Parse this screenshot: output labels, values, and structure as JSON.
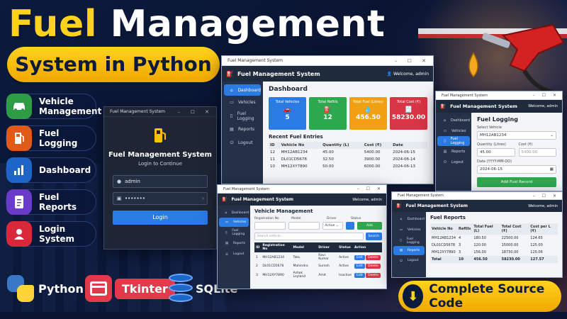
{
  "hero": {
    "title_line1_yellow": "Fuel",
    "title_line1_white": "Management",
    "title_line2": "System in Python"
  },
  "features": [
    {
      "label": "Vehicle Management",
      "icon": "car-icon",
      "color": "#2e9b45"
    },
    {
      "label": "Fuel Logging",
      "icon": "fuel-pump-icon",
      "color": "#e05a1a"
    },
    {
      "label": "Dashboard",
      "icon": "bar-chart-icon",
      "color": "#1f64c7"
    },
    {
      "label": "Fuel Reports",
      "icon": "document-icon",
      "color": "#6a3bc9"
    },
    {
      "label": "Login System",
      "icon": "user-icon",
      "color": "#d8283a"
    }
  ],
  "tech": {
    "python": "Python",
    "tkinter": "Tkinter",
    "sqlite": "SQLite"
  },
  "source_pill": "Complete Source Code",
  "login_win": {
    "window_title": "Fuel Management System",
    "heading": "Fuel Management System",
    "subheading": "Login to Continue",
    "username": "admin",
    "password": "•••••••",
    "login_button": "Login"
  },
  "dash_win": {
    "window_title": "Fuel Management System",
    "app_title": "Fuel Management System",
    "welcome": "Welcome, admin",
    "nav": [
      "Dashboard",
      "Vehicles",
      "Fuel Logging",
      "Reports",
      "Logout"
    ],
    "heading": "Dashboard",
    "cards": [
      {
        "label": "Total Vehicles",
        "value": "5",
        "color": "#2a7be4",
        "icon": "car-icon"
      },
      {
        "label": "Total Refills",
        "value": "12",
        "color": "#2ea84f",
        "icon": "fuel-pump-icon"
      },
      {
        "label": "Total Fuel (Litres)",
        "value": "456.50",
        "color": "#f0a010",
        "icon": "droplet-icon"
      },
      {
        "label": "Total Cost (₹)",
        "value": "58230.00",
        "color": "#d83545",
        "icon": "receipt-icon"
      }
    ],
    "recent_heading": "Recent Fuel Entries",
    "columns": [
      "ID",
      "Vehicle No",
      "Quantity (L)",
      "Cost (₹)",
      "Date"
    ],
    "rows": [
      [
        "12",
        "MH12AB1234",
        "45.00",
        "5400.00",
        "2024-06-15"
      ],
      [
        "11",
        "DL01CD5678",
        "32.50",
        "3900.00",
        "2024-06-14"
      ],
      [
        "10",
        "MH12XY7890",
        "50.00",
        "6000.00",
        "2024-06-13"
      ]
    ]
  },
  "fuel_win": {
    "window_title": "Fuel Management System",
    "app_title": "Fuel Management System",
    "welcome": "Welcome, admin",
    "nav": [
      "Dashboard",
      "Vehicles",
      "Fuel Logging",
      "Reports",
      "Logout"
    ],
    "heading": "Fuel Logging",
    "select_label": "Select Vehicle",
    "select_value": "MH12AB1234",
    "qty_label": "Quantity (Litres)",
    "qty_value": "45.00",
    "cost_label": "Cost (₹)",
    "cost_placeholder": "5400.00",
    "date_label": "Date (YYYY-MM-DD)",
    "date_value": "2024-06-15",
    "add_button": "Add Fuel Record"
  },
  "veh_win": {
    "window_title": "Fuel Management System",
    "app_title": "Fuel Management System",
    "welcome": "Welcome, admin",
    "nav": [
      "Dashboard",
      "Vehicles",
      "Fuel Logging",
      "Reports",
      "Logout"
    ],
    "heading": "Vehicle Management",
    "form_labels": [
      "Registration No",
      "Model",
      "Driver",
      "Status"
    ],
    "status_value": "Active",
    "add_button": "Add Vehicle",
    "search_placeholder": "Search vehicle...",
    "search_button": "Search",
    "columns": [
      "ID",
      "Registration No",
      "Model",
      "Driver",
      "Status",
      "Action"
    ],
    "rows": [
      [
        "1",
        "MH12AB1234",
        "Tata",
        "Ravi Kumar",
        "Active"
      ],
      [
        "2",
        "DL01CD5678",
        "Mahindra",
        "Suresh",
        "Active"
      ],
      [
        "3",
        "MH12XY7890",
        "Ashok Leyland",
        "Amit",
        "Inactive"
      ]
    ],
    "edit_label": "Edit",
    "delete_label": "Delete"
  },
  "rep_win": {
    "window_title": "Fuel Management System",
    "app_title": "Fuel Management System",
    "welcome": "Welcome, admin",
    "nav": [
      "Dashboard",
      "Vehicles",
      "Fuel Logging",
      "Reports",
      "Logout"
    ],
    "heading": "Fuel Reports",
    "columns": [
      "Vehicle No",
      "Refills",
      "Total Fuel (L)",
      "Total Cost (₹)",
      "Cost per L (₹)"
    ],
    "rows": [
      [
        "MH12AB1234",
        "4",
        "180.50",
        "22500.00",
        "124.65"
      ],
      [
        "DL01CD5678",
        "3",
        "120.00",
        "15000.00",
        "125.00"
      ],
      [
        "MH12XY7890",
        "3",
        "156.00",
        "18730.00",
        "120.06"
      ]
    ],
    "total": [
      "Total",
      "10",
      "456.50",
      "58230.00",
      "127.57"
    ]
  }
}
